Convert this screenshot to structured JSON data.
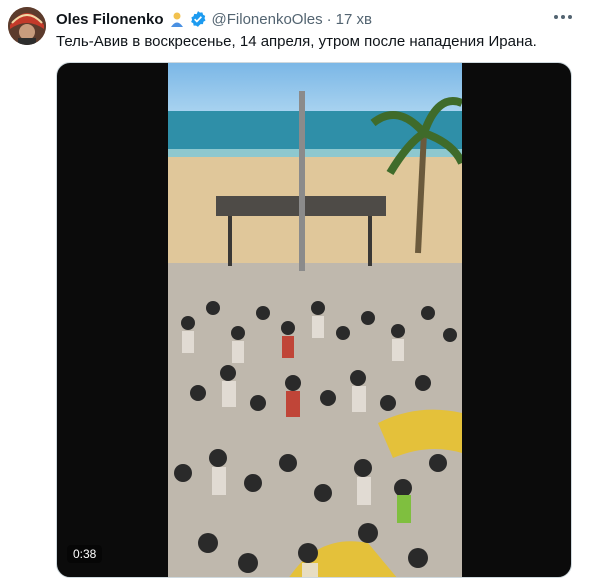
{
  "tweet": {
    "author_name": "Oles Filonenko",
    "author_emoji": "emoji-person-icon",
    "verified_icon": "verified-badge-icon",
    "handle": "@FilonenkoOles",
    "separator": "·",
    "time": "17 хв",
    "text": "Тель-Авив в воскресенье, 14 апреля, утром после нападения Ирана."
  },
  "video": {
    "duration": "0:38"
  },
  "colors": {
    "verified": "#1d9bf0",
    "secondary_text": "#536471"
  }
}
